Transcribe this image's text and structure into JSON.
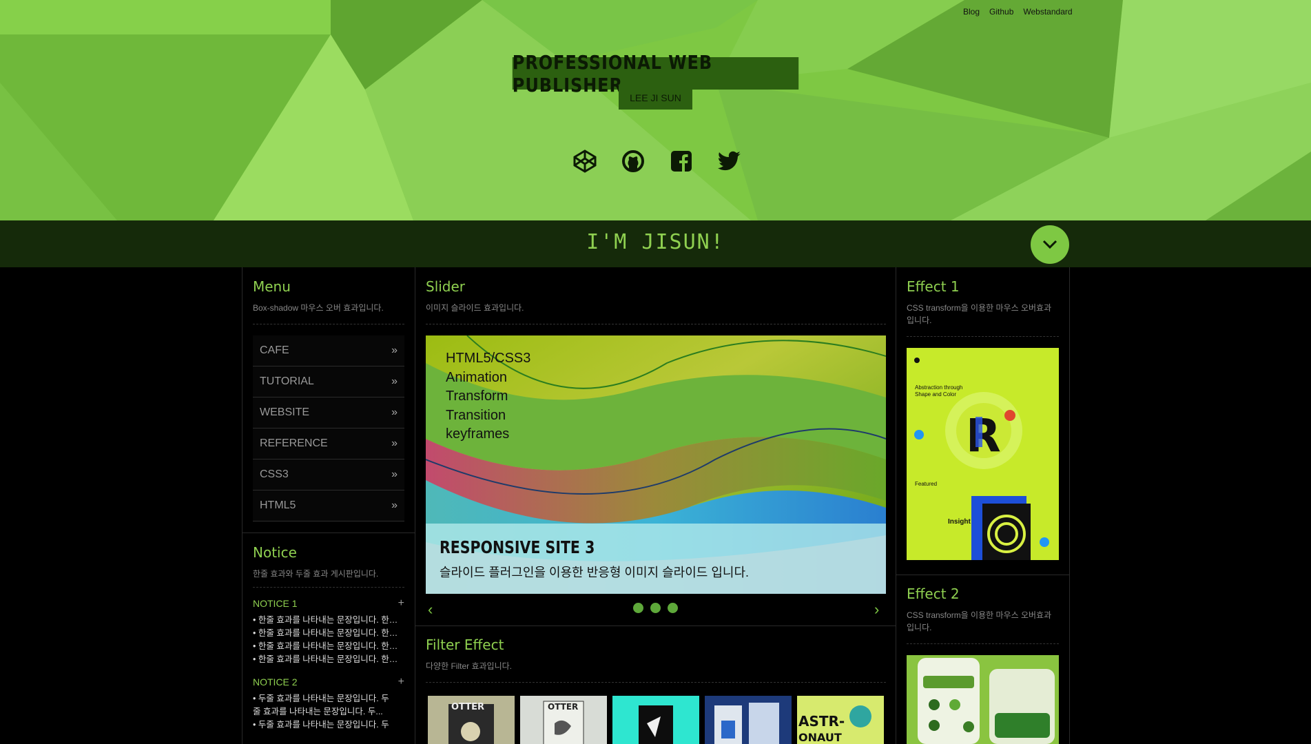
{
  "header": {
    "top_links": [
      "Blog",
      "Github",
      "Webstandard"
    ],
    "title": "PROFESSIONAL WEB PUBLISHER",
    "subtitle": "LEE JI SUN",
    "social_icons": [
      "codepen-icon",
      "github-icon",
      "facebook-icon",
      "twitter-icon"
    ]
  },
  "banner": {
    "tagline": "I'M JISUN!"
  },
  "menu": {
    "title": "Menu",
    "desc": "Box-shadow 마우스 오버 효과입니다.",
    "items": [
      {
        "label": "CAFE"
      },
      {
        "label": "TUTORIAL"
      },
      {
        "label": "WEBSITE"
      },
      {
        "label": "REFERENCE"
      },
      {
        "label": "CSS3"
      },
      {
        "label": "HTML5"
      }
    ]
  },
  "notice": {
    "title": "Notice",
    "desc": "한줄 효과와 두줄 효과 게시판입니다.",
    "group1": {
      "label": "NOTICE 1",
      "lines": [
        "• 한줄 효과를 나타내는 문장입니다. 한줄 효과를 나타내는 문장입니다.",
        "• 한줄 효과를 나타내는 문장입니다. 한줄 효과를 나타내는 문장입니다.",
        "• 한줄 효과를 나타내는 문장입니다. 한줄 효과를 나타내는 문장입니다.",
        "• 한줄 효과를 나타내는 문장입니다. 한줄 효과를 나타내는 문장입니다."
      ]
    },
    "group2": {
      "label": "NOTICE 2",
      "lines": [
        "• 두줄 효과를 나타내는 문장입니다. 두",
        "  줄 효과를 나타내는 문장입니다. 두...",
        "• 두줄 효과를 나타내는 문장입니다. 두"
      ]
    }
  },
  "slider": {
    "title": "Slider",
    "desc": "이미지 슬라이드 효과입니다.",
    "list": [
      "HTML5/CSS3",
      "Animation",
      "Transform",
      "Transition",
      "keyframes"
    ],
    "caption_title": "RESPONSIVE SITE 3",
    "caption_desc": "슬라이드 플러그인을 이용한 반응형 이미지 슬라이드 입니다."
  },
  "filter": {
    "title": "Filter Effect",
    "desc": "다양한 Filter 효과입니다."
  },
  "effect1": {
    "title": "Effect 1",
    "desc": "CSS transform을 이용한 마우스 오버효과입니다."
  },
  "effect2": {
    "title": "Effect 2",
    "desc": "CSS transform을 이용한 마우스 오버효과입니다."
  },
  "colors": {
    "accent": "#7ec843",
    "banner_bg": "#152a0a",
    "title_box": "#2c6010"
  }
}
